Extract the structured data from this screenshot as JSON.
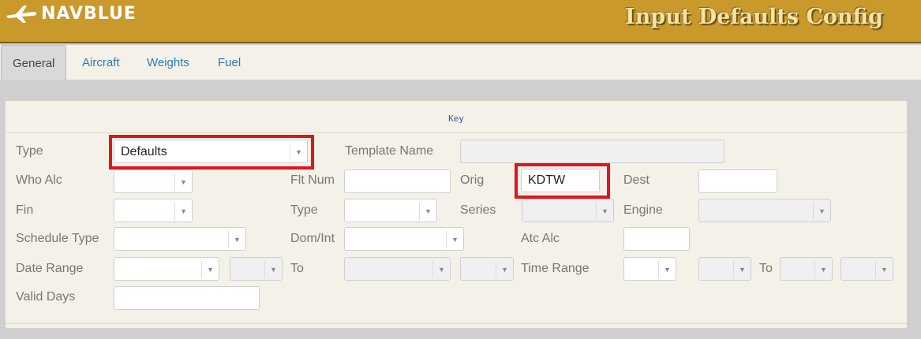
{
  "header": {
    "logo_text": "NAVBLUE",
    "title": "Input Defaults Config"
  },
  "tabs": [
    {
      "label": "General",
      "active": true
    },
    {
      "label": "Aircraft",
      "active": false
    },
    {
      "label": "Weights",
      "active": false
    },
    {
      "label": "Fuel",
      "active": false
    }
  ],
  "panel": {
    "key_label": "Key",
    "fields": {
      "type": {
        "label": "Type",
        "value": "Defaults"
      },
      "template_name": {
        "label": "Template Name",
        "value": ""
      },
      "who_alc": {
        "label": "Who Alc",
        "value": ""
      },
      "flt_num": {
        "label": "Flt Num",
        "value": ""
      },
      "orig": {
        "label": "Orig",
        "value": "KDTW"
      },
      "dest": {
        "label": "Dest",
        "value": ""
      },
      "fin": {
        "label": "Fin",
        "value": ""
      },
      "ac_type": {
        "label": "Type",
        "value": ""
      },
      "series": {
        "label": "Series",
        "value": ""
      },
      "engine": {
        "label": "Engine",
        "value": ""
      },
      "schedule_type": {
        "label": "Schedule Type",
        "value": ""
      },
      "dom_int": {
        "label": "Dom/Int",
        "value": ""
      },
      "atc_alc": {
        "label": "Atc Alc",
        "value": ""
      },
      "date_range": {
        "label": "Date Range",
        "to_label": "To"
      },
      "time_range": {
        "label": "Time Range",
        "to_label": "To"
      },
      "valid_days": {
        "label": "Valid Days",
        "value": ""
      }
    }
  },
  "colors": {
    "header_bg": "#c9992c",
    "highlight": "#e0141e",
    "tab_link": "#2a7ab8"
  }
}
